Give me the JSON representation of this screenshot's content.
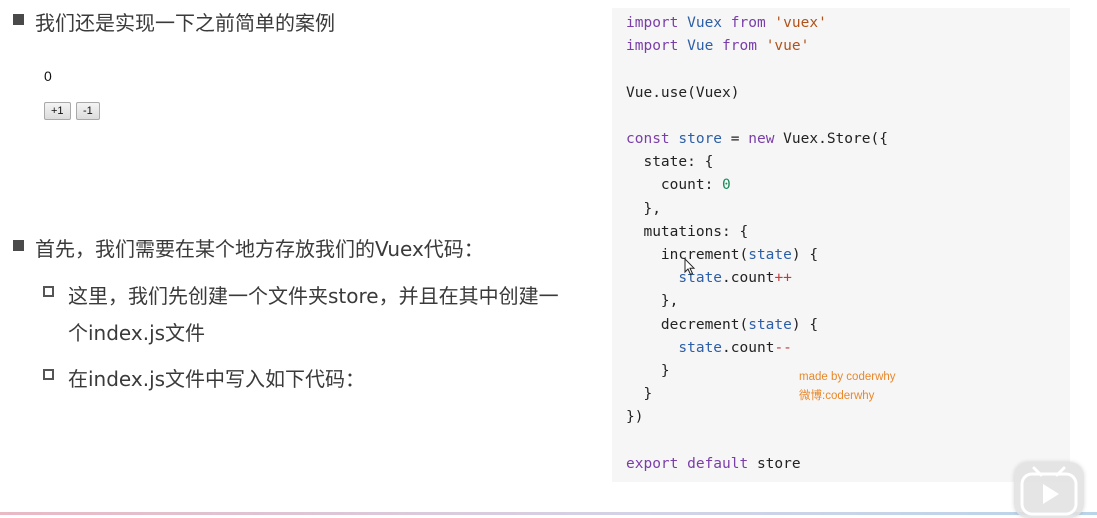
{
  "slide": {
    "heading1": "我们还是实现一下之前简单的案例",
    "heading2": "首先，我们需要在某个地方存放我们的Vuex代码：",
    "sub1_line1": "这里，我们先创建一个文件夹store，并且在其中创建一",
    "sub1_line2": "个index.js文件",
    "sub2": "在index.js文件中写入如下代码："
  },
  "demo": {
    "count": "0",
    "inc_label": "+1",
    "dec_label": "-1"
  },
  "code": [
    [
      [
        "kw",
        "import "
      ],
      [
        "var",
        "Vuex"
      ],
      [
        "kw",
        " from "
      ],
      [
        "str",
        "'vuex'"
      ]
    ],
    [
      [
        "kw",
        "import "
      ],
      [
        "var",
        "Vue"
      ],
      [
        "kw",
        " from "
      ],
      [
        "str",
        "'vue'"
      ]
    ],
    [],
    [
      [
        "",
        "Vue.use(Vuex)"
      ]
    ],
    [],
    [
      [
        "kw",
        "const "
      ],
      [
        "var",
        "store"
      ],
      [
        "",
        " = "
      ],
      [
        "kw",
        "new "
      ],
      [
        "",
        "Vuex.Store({"
      ]
    ],
    [
      [
        "",
        "  state: {"
      ]
    ],
    [
      [
        "",
        "    count: "
      ],
      [
        "num",
        "0"
      ]
    ],
    [
      [
        "",
        "  },"
      ]
    ],
    [
      [
        "",
        "  mutations: {"
      ]
    ],
    [
      [
        "",
        "    increment("
      ],
      [
        "var",
        "state"
      ],
      [
        "",
        ") {"
      ]
    ],
    [
      [
        "",
        "      "
      ],
      [
        "var",
        "state"
      ],
      [
        "",
        ".count"
      ],
      [
        "op",
        "++"
      ]
    ],
    [
      [
        "",
        "    },"
      ]
    ],
    [
      [
        "",
        "    decrement("
      ],
      [
        "var",
        "state"
      ],
      [
        "",
        ") {"
      ]
    ],
    [
      [
        "",
        "      "
      ],
      [
        "var",
        "state"
      ],
      [
        "",
        ".count"
      ],
      [
        "op",
        "--"
      ]
    ],
    [
      [
        "",
        "    }"
      ]
    ],
    [
      [
        "",
        "  }"
      ]
    ],
    [
      [
        "",
        "})"
      ]
    ],
    [],
    [
      [
        "kw",
        "export default "
      ],
      [
        "",
        "store"
      ]
    ]
  ],
  "credit": {
    "line1": "made by coderwhy",
    "line2": "微博:coderwhy"
  },
  "colors": {
    "keyword": "#7a3ea8",
    "variable": "#2c5fa8",
    "string": "#b0521a",
    "number": "#1a8a5a",
    "operator": "#c33a3a",
    "credit": "#e8882b"
  },
  "icons": {
    "cursor": "mouse-cursor-icon",
    "play": "play-icon"
  }
}
